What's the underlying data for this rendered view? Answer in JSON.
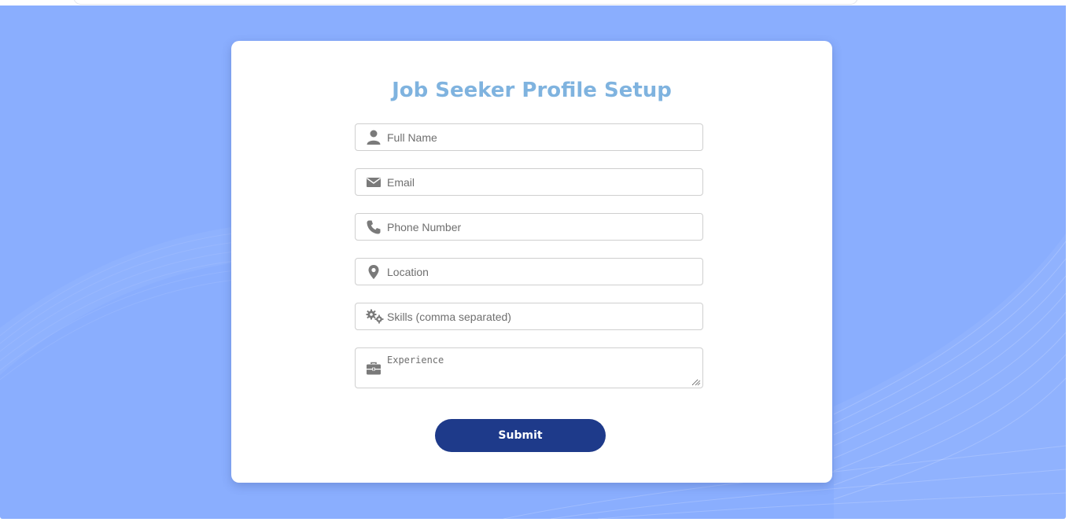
{
  "form": {
    "title": "Job Seeker Profile Setup",
    "fields": [
      {
        "icon": "user-icon",
        "placeholder": "Full Name",
        "value": ""
      },
      {
        "icon": "envelope-icon",
        "placeholder": "Email",
        "value": ""
      },
      {
        "icon": "phone-icon",
        "placeholder": "Phone Number",
        "value": ""
      },
      {
        "icon": "map-marker-icon",
        "placeholder": "Location",
        "value": ""
      },
      {
        "icon": "gears-icon",
        "placeholder": "Skills (comma separated)",
        "value": ""
      }
    ],
    "experience": {
      "icon": "briefcase-icon",
      "placeholder": "Experience",
      "value": ""
    },
    "submit_label": "Submit"
  },
  "colors": {
    "background": "#8aaefe",
    "title": "#7fb3df",
    "button": "#1e3a8a",
    "icon": "#7a7a7a"
  }
}
